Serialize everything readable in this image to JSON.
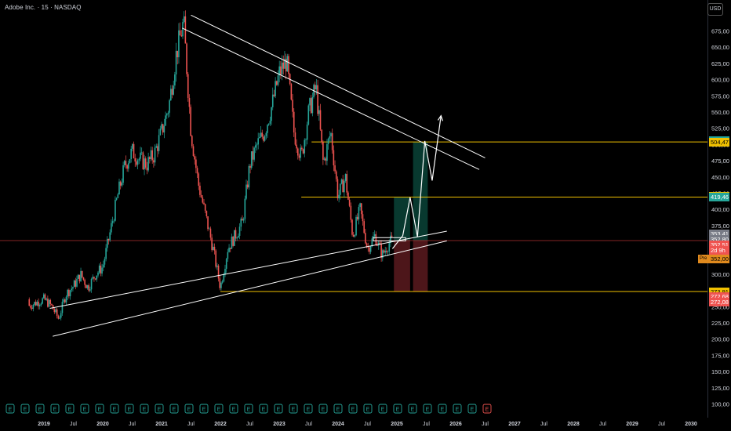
{
  "header": {
    "title": "Adobe Inc. · 15 · NASDAQ",
    "currency": "USD"
  },
  "colors": {
    "bg": "#000000",
    "up": "#26a69a",
    "down": "#ef5350",
    "text": "#d1d4dc",
    "level": "#f0c000",
    "trend": "#ffffff",
    "current": "#b03030",
    "profit": "#0b4c3f",
    "loss": "#5a1a1f",
    "earnings": "#26a69a",
    "earningsDown": "#ef5350"
  },
  "chart_data": {
    "type": "candlestick",
    "ylim": [
      90,
      690
    ],
    "y_ticks": [
      "100,00",
      "125,00",
      "150,00",
      "175,00",
      "200,00",
      "225,00",
      "250,00",
      "275,00",
      "300,00",
      "325,00",
      "350,00",
      "375,00",
      "400,00",
      "425,00",
      "450,00",
      "475,00",
      "500,00",
      "525,00",
      "550,00",
      "575,00",
      "600,00",
      "625,00",
      "650,00",
      "675,00"
    ],
    "x_ticks": [
      "2019",
      "Jul",
      "2020",
      "Jul",
      "2021",
      "Jul",
      "2022",
      "Jul",
      "2023",
      "Jul",
      "2024",
      "Jul",
      "2025",
      "Jul",
      "2026",
      "Jul",
      "2027",
      "Jul",
      "2028",
      "Jul",
      "2029",
      "Jul",
      "2030"
    ],
    "price_path": [
      [
        0,
        262
      ],
      [
        0.25,
        252
      ],
      [
        0.5,
        232
      ],
      [
        0.75,
        270
      ],
      [
        1.0,
        282
      ],
      [
        1.25,
        300
      ],
      [
        1.5,
        280
      ],
      [
        1.75,
        300
      ],
      [
        2.0,
        312
      ],
      [
        2.25,
        365
      ],
      [
        2.5,
        420
      ],
      [
        2.75,
        468
      ],
      [
        3.0,
        490
      ],
      [
        3.25,
        478
      ],
      [
        3.5,
        470
      ],
      [
        3.75,
        485
      ],
      [
        4.0,
        520
      ],
      [
        4.25,
        560
      ],
      [
        4.5,
        640
      ],
      [
        4.75,
        690
      ],
      [
        5.0,
        520
      ],
      [
        5.25,
        440
      ],
      [
        5.5,
        390
      ],
      [
        5.75,
        340
      ],
      [
        6.0,
        280
      ],
      [
        6.25,
        340
      ],
      [
        6.5,
        360
      ],
      [
        6.75,
        380
      ],
      [
        7.0,
        470
      ],
      [
        7.25,
        500
      ],
      [
        7.5,
        520
      ],
      [
        7.75,
        560
      ],
      [
        8.0,
        610
      ],
      [
        8.25,
        630
      ],
      [
        8.5,
        520
      ],
      [
        8.75,
        480
      ],
      [
        9.0,
        550
      ],
      [
        9.25,
        590
      ],
      [
        9.5,
        470
      ],
      [
        9.75,
        520
      ],
      [
        10.0,
        420
      ],
      [
        10.25,
        450
      ],
      [
        10.5,
        360
      ],
      [
        10.75,
        400
      ],
      [
        11.0,
        340
      ],
      [
        11.25,
        360
      ],
      [
        11.5,
        330
      ],
      [
        11.75,
        350
      ],
      [
        11.85,
        352.5
      ]
    ],
    "levels": [
      {
        "price": 504.47,
        "start_t": 9.1
      },
      {
        "price": 419.46,
        "start_t": 8.75
      },
      {
        "price": 273.91,
        "start_t": 6.0
      }
    ],
    "trendlines": [
      {
        "p1": [
          5.0,
          700
        ],
        "p2": [
          15.0,
          480
        ]
      },
      {
        "p1": [
          4.7,
          680
        ],
        "p2": [
          14.8,
          462
        ]
      },
      {
        "p1": [
          0.2,
          248
        ],
        "p2": [
          13.7,
          367
        ]
      },
      {
        "p1": [
          0.3,
          205
        ],
        "p2": [
          13.7,
          352
        ]
      }
    ],
    "current_price": 352.51,
    "positions": [
      {
        "t0": 11.9,
        "t1": 12.45,
        "entry": 352.51,
        "target": 419.46,
        "stop": 273.91
      },
      {
        "t0": 12.55,
        "t1": 13.05,
        "entry": 352.51,
        "target": 504.47,
        "stop": 273.91
      }
    ],
    "projection": [
      [
        11.85,
        340
      ],
      [
        12.2,
        360
      ],
      [
        12.45,
        419
      ],
      [
        12.7,
        358
      ],
      [
        12.95,
        506
      ],
      [
        13.2,
        445
      ],
      [
        13.5,
        545
      ]
    ],
    "box": {
      "t0": 11.2,
      "t1": 12.3,
      "p0": 357,
      "p1": 352
    },
    "earnings_markers": [
      "E",
      "E",
      "E",
      "E",
      "E",
      "E",
      "E",
      "E",
      "E",
      "E",
      "E",
      "E",
      "E",
      "E",
      "E",
      "E",
      "E",
      "E",
      "E",
      "E",
      "E",
      "E",
      "E",
      "E",
      "E",
      "E",
      "E",
      "E",
      "E",
      "E",
      "E",
      "E"
    ],
    "last_marker": "E",
    "price_tags": [
      {
        "label": "506,31",
        "price": 506.31,
        "bg": "#26a69a",
        "fg": "#ffffff"
      },
      {
        "label": "504,47",
        "price": 504.47,
        "bg": "#f0c000",
        "fg": "#000000"
      },
      {
        "label": "420,69",
        "price": 420.69,
        "bg": "#f0c000",
        "fg": "#000000"
      },
      {
        "label": "419,46",
        "price": 419.46,
        "bg": "#26a69a",
        "fg": "#ffffff"
      },
      {
        "label": "353,41",
        "price": 362.2,
        "bg": "#787b86",
        "fg": "#ffffff"
      },
      {
        "label": "352,80",
        "price": 354.2,
        "bg": "#787b86",
        "fg": "#ffffff"
      },
      {
        "label": "352,51",
        "price": 346.1,
        "bg": "#ef5350",
        "fg": "#ffffff"
      },
      {
        "label": "2d 9h",
        "price": 337.9,
        "bg": "#ef5350",
        "fg": "#ffffff"
      },
      {
        "label": "273,91",
        "price": 273.91,
        "bg": "#f0c000",
        "fg": "#000000"
      },
      {
        "label": "272,68",
        "price": 265.7,
        "bg": "#ef5350",
        "fg": "#ffffff"
      },
      {
        "label": "272,08",
        "price": 257.5,
        "bg": "#ef5350",
        "fg": "#ffffff"
      }
    ],
    "pre_tag": {
      "badge": "Pre",
      "label": "352,00",
      "price": 324.0
    }
  }
}
